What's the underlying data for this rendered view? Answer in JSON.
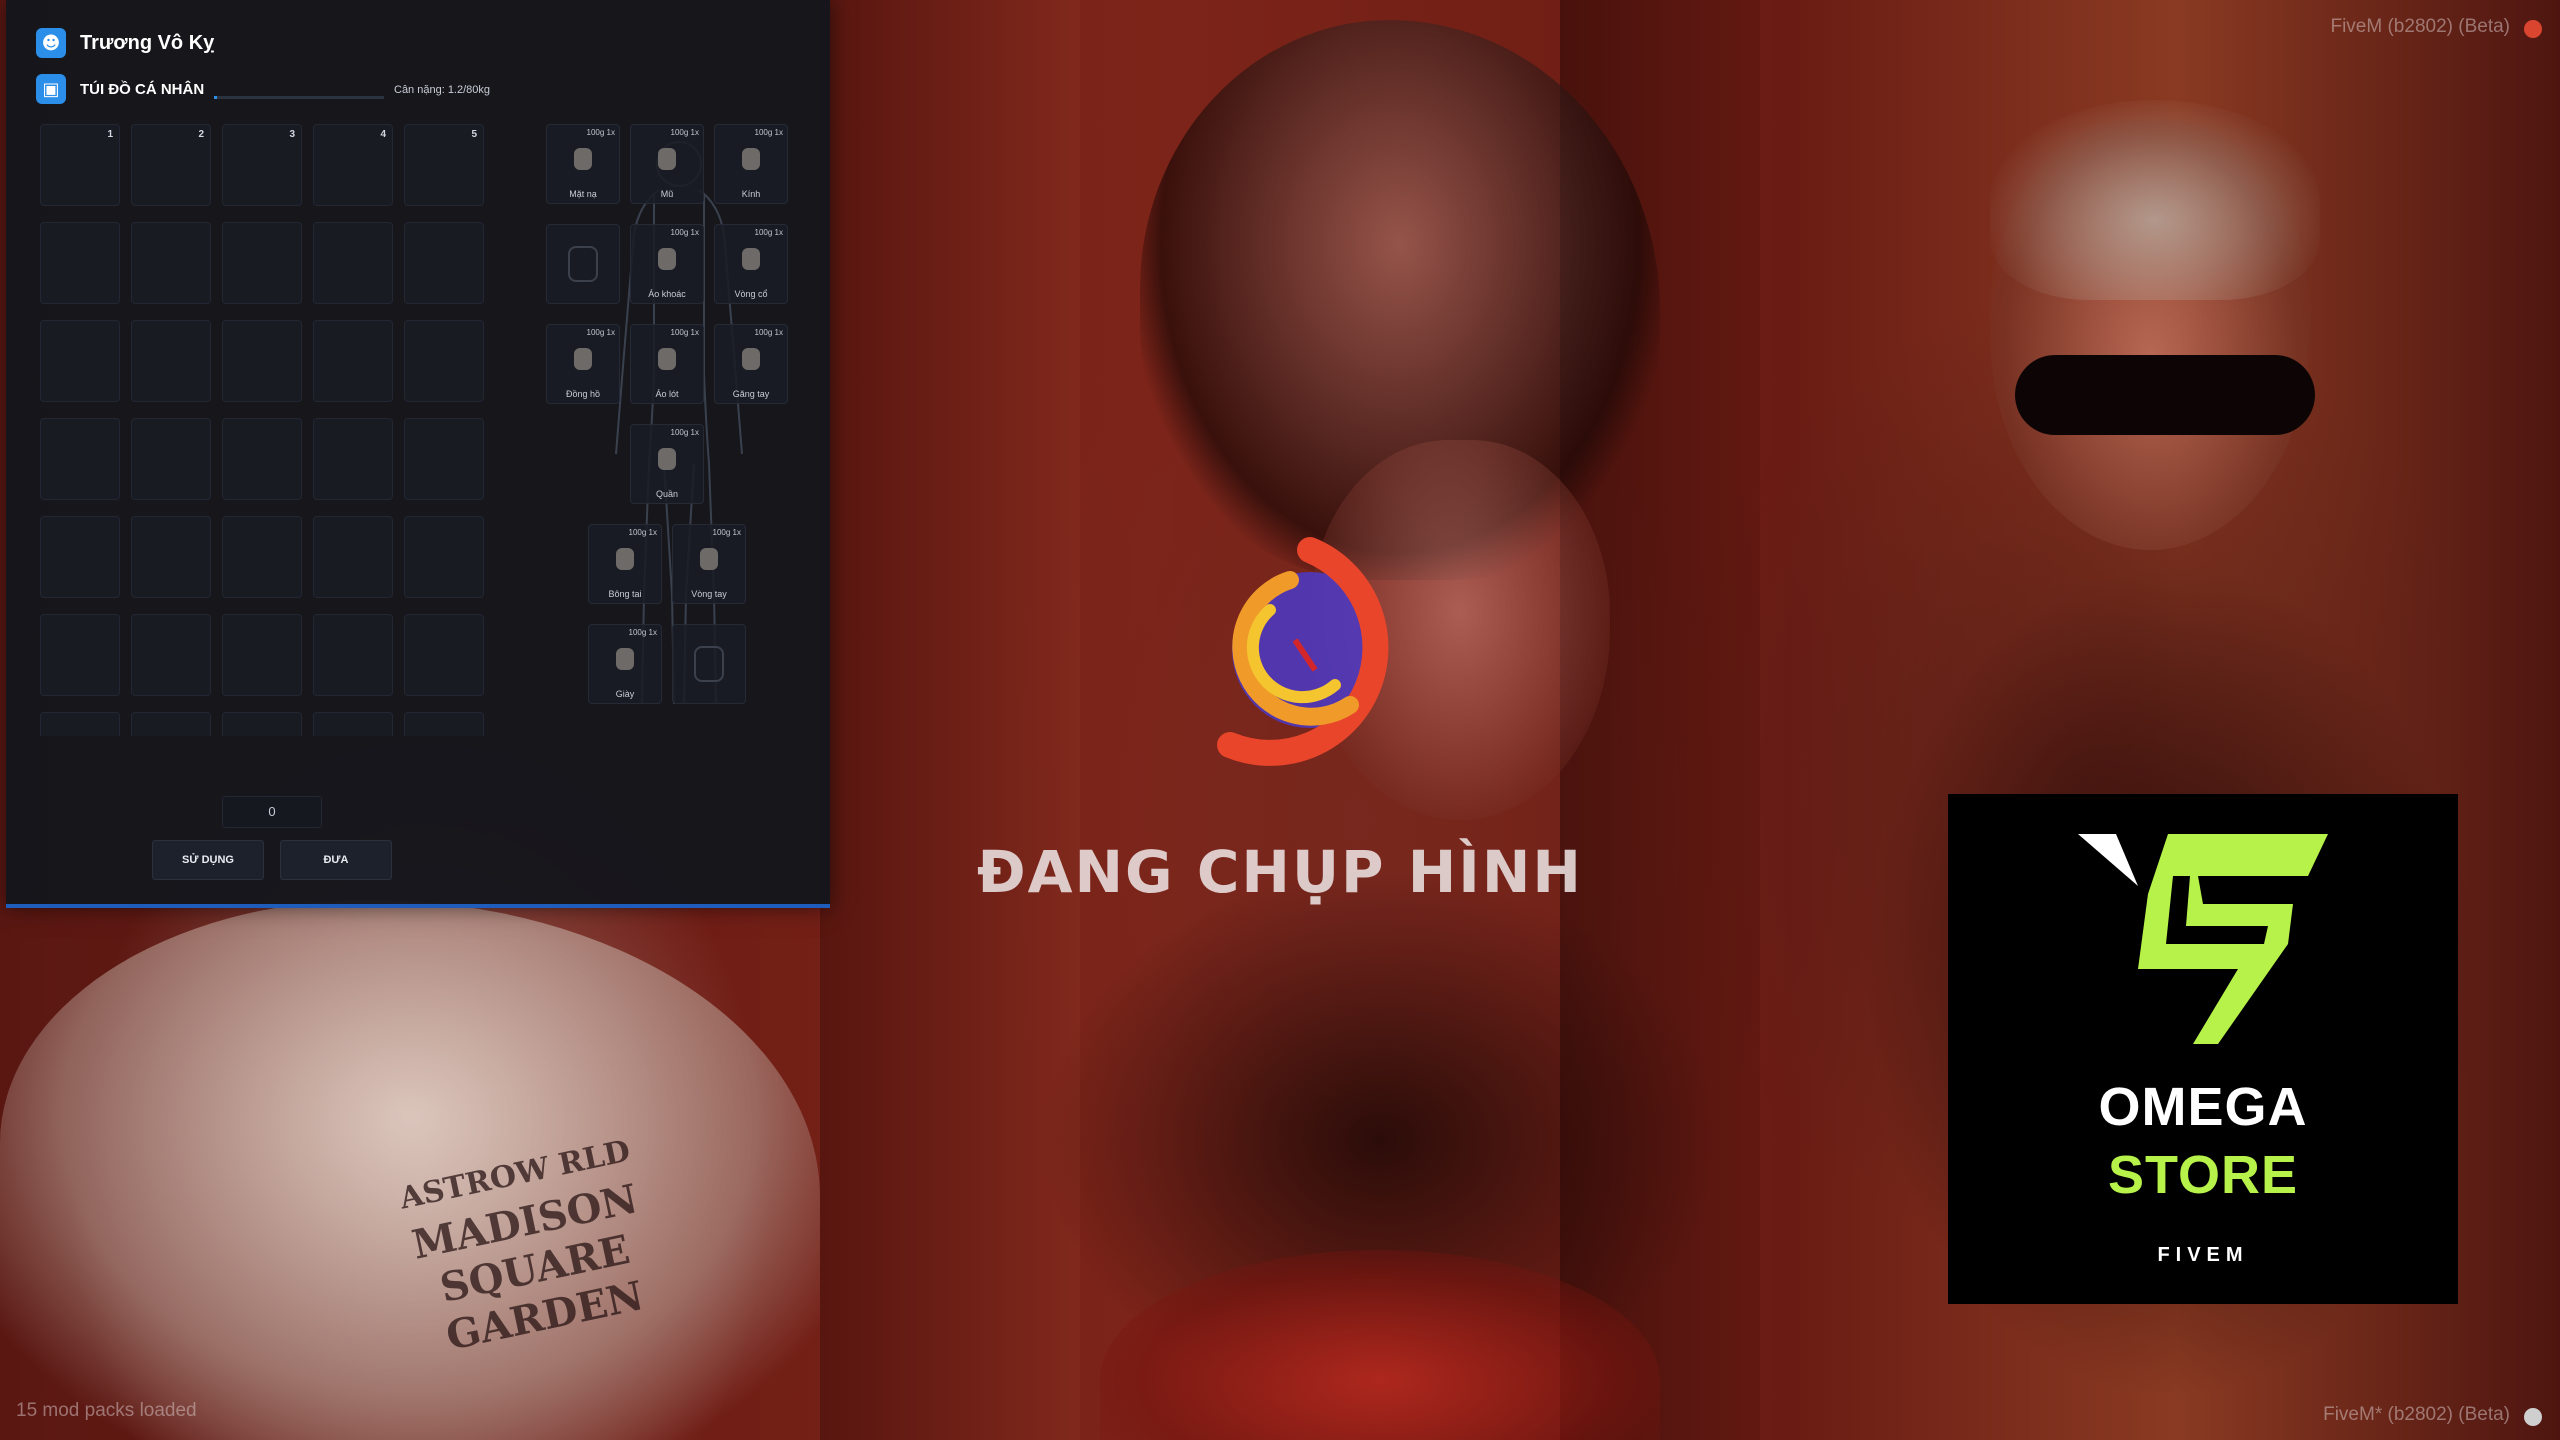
{
  "player": {
    "name": "Trương Vô Kỵ"
  },
  "inventory": {
    "title": "TÚI ĐỒ CÁ NHÂN",
    "weight_label": "Cân nặng: 1.2/80kg",
    "weight_fraction": 0.015,
    "hotbar_numbers": [
      "1",
      "2",
      "3",
      "4",
      "5"
    ],
    "quantity": "0",
    "use_label": "SỬ DỤNG",
    "give_label": "ĐƯA"
  },
  "equipment": [
    {
      "meta": "100g 1x",
      "label": "Mặt nạ"
    },
    {
      "meta": "100g 1x",
      "label": "Mũ"
    },
    {
      "meta": "100g 1x",
      "label": "Kính"
    },
    {
      "meta": "",
      "label": ""
    },
    {
      "meta": "100g 1x",
      "label": "Áo khoác"
    },
    {
      "meta": "100g 1x",
      "label": "Vòng cổ"
    },
    {
      "meta": "100g 1x",
      "label": "Đồng hồ"
    },
    {
      "meta": "100g 1x",
      "label": "Áo lót"
    },
    {
      "meta": "100g 1x",
      "label": "Găng tay"
    },
    {
      "meta": "100g 1x",
      "label": "Quần"
    },
    {
      "meta": "100g 1x",
      "label": "Bông tai"
    },
    {
      "meta": "100g 1x",
      "label": "Vòng tay"
    },
    {
      "meta": "100g 1x",
      "label": "Giày"
    },
    {
      "meta": "",
      "label": ""
    }
  ],
  "overlay": {
    "snap_text": "ĐANG CHỤP HÌNH"
  },
  "omega": {
    "line1": "OMEGA",
    "line2": "STORE",
    "line3": "FIVEM",
    "accent": "#b7f24a"
  },
  "corners": {
    "top_right": "FiveM (b2802) (Beta)",
    "bottom_right": "FiveM* (b2802) (Beta)",
    "bottom_left": "15 mod packs loaded"
  },
  "shirt_print": {
    "top": "ASTROW RLD",
    "line1": "MADISON",
    "line2": "SQUARE",
    "line3": "GARDEN"
  },
  "colors": {
    "panel_bg": "#14161c",
    "accent_blue": "#2b8ee8"
  }
}
